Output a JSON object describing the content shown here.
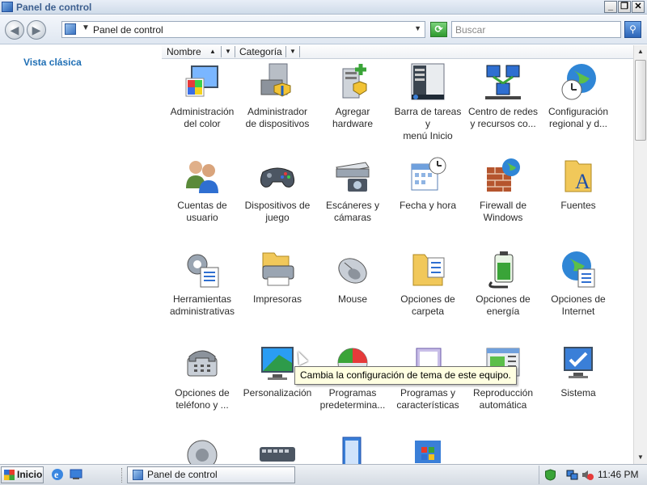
{
  "window": {
    "title": "Panel de control",
    "controls": {
      "minimize": "_",
      "restore": "❐",
      "close": "✕"
    }
  },
  "address_bar": {
    "path": "Panel de control",
    "search_placeholder": "Buscar"
  },
  "sidebar": {
    "classic_view_link": "Vista clásica"
  },
  "column_headers": {
    "name": "Nombre",
    "category": "Categoría"
  },
  "items": [
    {
      "line1": "Administración",
      "line2": "del color",
      "icon": "color-management-icon"
    },
    {
      "line1": "Administrador",
      "line2": "de dispositivos",
      "icon": "device-manager-icon"
    },
    {
      "line1": "Agregar",
      "line2": "hardware",
      "icon": "add-hardware-icon"
    },
    {
      "line1": "Barra de tareas y",
      "line2": "menú Inicio",
      "icon": "taskbar-start-menu-icon"
    },
    {
      "line1": "Centro de redes",
      "line2": "y recursos co...",
      "icon": "network-center-icon"
    },
    {
      "line1": "Configuración",
      "line2": "regional y d...",
      "icon": "regional-settings-icon"
    },
    {
      "line1": "Cuentas de",
      "line2": "usuario",
      "icon": "user-accounts-icon"
    },
    {
      "line1": "Dispositivos de",
      "line2": "juego",
      "icon": "game-controllers-icon"
    },
    {
      "line1": "Escáneres y",
      "line2": "cámaras",
      "icon": "scanners-cameras-icon"
    },
    {
      "line1": "Fecha y hora",
      "line2": "",
      "icon": "date-time-icon"
    },
    {
      "line1": "Firewall de",
      "line2": "Windows",
      "icon": "firewall-icon"
    },
    {
      "line1": "Fuentes",
      "line2": "",
      "icon": "fonts-icon"
    },
    {
      "line1": "Herramientas",
      "line2": "administrativas",
      "icon": "admin-tools-icon"
    },
    {
      "line1": "Impresoras",
      "line2": "",
      "icon": "printers-icon"
    },
    {
      "line1": "Mouse",
      "line2": "",
      "icon": "mouse-icon"
    },
    {
      "line1": "Opciones de",
      "line2": "carpeta",
      "icon": "folder-options-icon"
    },
    {
      "line1": "Opciones de",
      "line2": "energía",
      "icon": "power-options-icon"
    },
    {
      "line1": "Opciones de",
      "line2": "Internet",
      "icon": "internet-options-icon"
    },
    {
      "line1": "Opciones de",
      "line2": "teléfono y ...",
      "icon": "phone-modem-icon"
    },
    {
      "line1": "Personalización",
      "line2": "",
      "icon": "personalization-icon"
    },
    {
      "line1": "Programas",
      "line2": "predetermina...",
      "icon": "default-programs-icon"
    },
    {
      "line1": "Programas y",
      "line2": "características",
      "icon": "programs-features-icon"
    },
    {
      "line1": "Reproducción",
      "line2": "automática",
      "icon": "autoplay-icon"
    },
    {
      "line1": "Sistema",
      "line2": "",
      "icon": "system-icon"
    },
    {
      "line1": "",
      "line2": "",
      "icon": "sound-icon"
    },
    {
      "line1": "",
      "line2": "",
      "icon": "keyboard-icon"
    },
    {
      "line1": "",
      "line2": "",
      "icon": "tablet-icon"
    },
    {
      "line1": "",
      "line2": "",
      "icon": "welcome-center-icon"
    }
  ],
  "tooltip": "Cambia la configuración de tema de este equipo.",
  "taskbar": {
    "start_label": "Inicio",
    "task_button": "Panel de control",
    "clock": "11:46 PM"
  }
}
